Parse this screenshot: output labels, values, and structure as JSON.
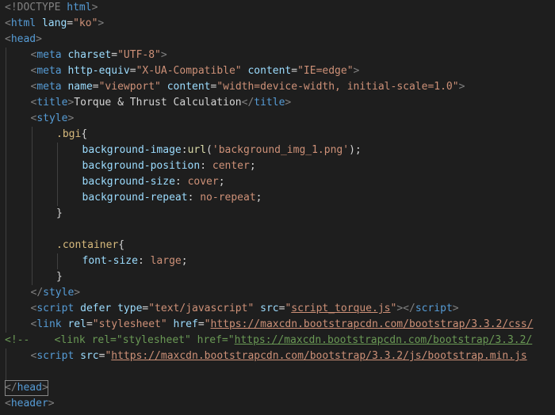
{
  "editor": {
    "language": "html",
    "theme_colors": {
      "background": "#1e1e1e",
      "punctuation": "#808080",
      "tag": "#569cd6",
      "attribute": "#9cdcfe",
      "string": "#ce9178",
      "text": "#d4d4d4",
      "selector": "#d7ba7d",
      "property": "#9cdcfe",
      "value": "#ce9178",
      "function": "#dcdcaa",
      "comment": "#6a9955"
    },
    "lines": [
      {
        "indent": 0,
        "tokens": [
          {
            "t": "<!DOCTYPE ",
            "c": "punct"
          },
          {
            "t": "html",
            "c": "tag"
          },
          {
            "t": ">",
            "c": "punct"
          }
        ]
      },
      {
        "indent": 0,
        "tokens": [
          {
            "t": "<",
            "c": "punct"
          },
          {
            "t": "html",
            "c": "tag"
          },
          {
            "t": " ",
            "c": "text"
          },
          {
            "t": "lang",
            "c": "attr"
          },
          {
            "t": "=",
            "c": "text"
          },
          {
            "t": "\"ko\"",
            "c": "str"
          },
          {
            "t": ">",
            "c": "punct"
          }
        ]
      },
      {
        "indent": 0,
        "tokens": [
          {
            "t": "<",
            "c": "punct"
          },
          {
            "t": "head",
            "c": "tag"
          },
          {
            "t": ">",
            "c": "punct"
          }
        ]
      },
      {
        "indent": 1,
        "tokens": [
          {
            "t": "<",
            "c": "punct"
          },
          {
            "t": "meta",
            "c": "tag"
          },
          {
            "t": " ",
            "c": "text"
          },
          {
            "t": "charset",
            "c": "attr"
          },
          {
            "t": "=",
            "c": "text"
          },
          {
            "t": "\"UTF-8\"",
            "c": "str"
          },
          {
            "t": ">",
            "c": "punct"
          }
        ]
      },
      {
        "indent": 1,
        "tokens": [
          {
            "t": "<",
            "c": "punct"
          },
          {
            "t": "meta",
            "c": "tag"
          },
          {
            "t": " ",
            "c": "text"
          },
          {
            "t": "http-equiv",
            "c": "attr"
          },
          {
            "t": "=",
            "c": "text"
          },
          {
            "t": "\"X-UA-Compatible\"",
            "c": "str"
          },
          {
            "t": " ",
            "c": "text"
          },
          {
            "t": "content",
            "c": "attr"
          },
          {
            "t": "=",
            "c": "text"
          },
          {
            "t": "\"IE=edge\"",
            "c": "str"
          },
          {
            "t": ">",
            "c": "punct"
          }
        ]
      },
      {
        "indent": 1,
        "tokens": [
          {
            "t": "<",
            "c": "punct"
          },
          {
            "t": "meta",
            "c": "tag"
          },
          {
            "t": " ",
            "c": "text"
          },
          {
            "t": "name",
            "c": "attr"
          },
          {
            "t": "=",
            "c": "text"
          },
          {
            "t": "\"viewport\"",
            "c": "str"
          },
          {
            "t": " ",
            "c": "text"
          },
          {
            "t": "content",
            "c": "attr"
          },
          {
            "t": "=",
            "c": "text"
          },
          {
            "t": "\"width=device-width, initial-scale=1.0\"",
            "c": "str"
          },
          {
            "t": ">",
            "c": "punct"
          }
        ]
      },
      {
        "indent": 1,
        "tokens": [
          {
            "t": "<",
            "c": "punct"
          },
          {
            "t": "title",
            "c": "tag"
          },
          {
            "t": ">",
            "c": "punct"
          },
          {
            "t": "Torque & Thrust Calculation",
            "c": "text"
          },
          {
            "t": "</",
            "c": "punct"
          },
          {
            "t": "title",
            "c": "tag"
          },
          {
            "t": ">",
            "c": "punct"
          }
        ]
      },
      {
        "indent": 1,
        "tokens": [
          {
            "t": "<",
            "c": "punct"
          },
          {
            "t": "style",
            "c": "tag"
          },
          {
            "t": ">",
            "c": "punct"
          }
        ]
      },
      {
        "indent": 2,
        "tokens": [
          {
            "t": ".bgi",
            "c": "sel"
          },
          {
            "t": "{",
            "c": "text"
          }
        ]
      },
      {
        "indent": 3,
        "tokens": [
          {
            "t": "background-image",
            "c": "prop"
          },
          {
            "t": ":",
            "c": "text"
          },
          {
            "t": "url",
            "c": "func"
          },
          {
            "t": "(",
            "c": "text"
          },
          {
            "t": "'background_img_1.png'",
            "c": "val"
          },
          {
            "t": ");",
            "c": "text"
          }
        ]
      },
      {
        "indent": 3,
        "tokens": [
          {
            "t": "background-position",
            "c": "prop"
          },
          {
            "t": ": ",
            "c": "text"
          },
          {
            "t": "center",
            "c": "val"
          },
          {
            "t": ";",
            "c": "text"
          }
        ]
      },
      {
        "indent": 3,
        "tokens": [
          {
            "t": "background-size",
            "c": "prop"
          },
          {
            "t": ": ",
            "c": "text"
          },
          {
            "t": "cover",
            "c": "val"
          },
          {
            "t": ";",
            "c": "text"
          }
        ]
      },
      {
        "indent": 3,
        "tokens": [
          {
            "t": "background-repeat",
            "c": "prop"
          },
          {
            "t": ": ",
            "c": "text"
          },
          {
            "t": "no-repeat",
            "c": "val"
          },
          {
            "t": ";",
            "c": "text"
          }
        ]
      },
      {
        "indent": 2,
        "tokens": [
          {
            "t": "}",
            "c": "text"
          }
        ]
      },
      {
        "indent": 2,
        "tokens": []
      },
      {
        "indent": 2,
        "tokens": [
          {
            "t": ".container",
            "c": "sel"
          },
          {
            "t": "{",
            "c": "text"
          }
        ]
      },
      {
        "indent": 3,
        "tokens": [
          {
            "t": "font-size",
            "c": "prop"
          },
          {
            "t": ": ",
            "c": "text"
          },
          {
            "t": "large",
            "c": "val"
          },
          {
            "t": ";",
            "c": "text"
          }
        ]
      },
      {
        "indent": 2,
        "tokens": [
          {
            "t": "}",
            "c": "text"
          }
        ]
      },
      {
        "indent": 1,
        "tokens": [
          {
            "t": "</",
            "c": "punct"
          },
          {
            "t": "style",
            "c": "tag"
          },
          {
            "t": ">",
            "c": "punct"
          }
        ]
      },
      {
        "indent": 1,
        "tokens": [
          {
            "t": "<",
            "c": "punct"
          },
          {
            "t": "script",
            "c": "tag"
          },
          {
            "t": " ",
            "c": "text"
          },
          {
            "t": "defer",
            "c": "attr"
          },
          {
            "t": " ",
            "c": "text"
          },
          {
            "t": "type",
            "c": "attr"
          },
          {
            "t": "=",
            "c": "text"
          },
          {
            "t": "\"text/javascript\"",
            "c": "str"
          },
          {
            "t": " ",
            "c": "text"
          },
          {
            "t": "src",
            "c": "attr"
          },
          {
            "t": "=",
            "c": "text"
          },
          {
            "t": "\"",
            "c": "str"
          },
          {
            "t": "script_torque.js",
            "c": "str",
            "link": true
          },
          {
            "t": "\"",
            "c": "str"
          },
          {
            "t": "></",
            "c": "punct"
          },
          {
            "t": "script",
            "c": "tag"
          },
          {
            "t": ">",
            "c": "punct"
          }
        ]
      },
      {
        "indent": 1,
        "tokens": [
          {
            "t": "<",
            "c": "punct"
          },
          {
            "t": "link",
            "c": "tag"
          },
          {
            "t": " ",
            "c": "text"
          },
          {
            "t": "rel",
            "c": "attr"
          },
          {
            "t": "=",
            "c": "text"
          },
          {
            "t": "\"stylesheet\"",
            "c": "str"
          },
          {
            "t": " ",
            "c": "text"
          },
          {
            "t": "href",
            "c": "attr"
          },
          {
            "t": "=",
            "c": "text"
          },
          {
            "t": "\"",
            "c": "str"
          },
          {
            "t": "https://maxcdn.bootstrapcdn.com/bootstrap/3.3.2/css/",
            "c": "str",
            "link": true
          }
        ]
      },
      {
        "indent": 0,
        "tokens": [
          {
            "t": "<!--    <link rel=\"stylesheet\" href=\"",
            "c": "comment"
          },
          {
            "t": "https://maxcdn.bootstrapcdn.com/bootstrap/3.3.2/",
            "c": "comment",
            "link": true
          }
        ]
      },
      {
        "indent": 1,
        "tokens": [
          {
            "t": "<",
            "c": "punct"
          },
          {
            "t": "script",
            "c": "tag"
          },
          {
            "t": " ",
            "c": "text"
          },
          {
            "t": "src",
            "c": "attr"
          },
          {
            "t": "=",
            "c": "text"
          },
          {
            "t": "\"",
            "c": "str"
          },
          {
            "t": "https://maxcdn.bootstrapcdn.com/bootstrap/3.3.2/js/bootstrap.min.js",
            "c": "str",
            "link": true
          }
        ]
      },
      {
        "indent": 1,
        "tokens": []
      },
      {
        "indent": 0,
        "boxed": true,
        "tokens": [
          {
            "t": "</",
            "c": "punct"
          },
          {
            "t": "head",
            "c": "tag"
          },
          {
            "t": ">",
            "c": "punct"
          }
        ]
      },
      {
        "indent": 0,
        "tokens": [
          {
            "t": "<",
            "c": "punct"
          },
          {
            "t": "header",
            "c": "tag"
          },
          {
            "t": ">",
            "c": "punct"
          }
        ]
      }
    ]
  }
}
